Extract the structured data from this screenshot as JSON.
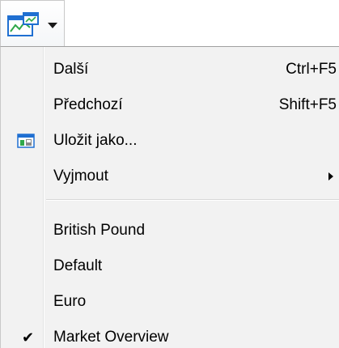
{
  "toolbar": {
    "button_icon": "chart-window-icon",
    "arrow_icon": "dropdown-arrow-icon"
  },
  "menu": {
    "items": [
      {
        "label": "Další",
        "shortcut": "Ctrl+F5"
      },
      {
        "label": "Předchozí",
        "shortcut": "Shift+F5"
      },
      {
        "label": "Uložit jako...",
        "icon": "save-as-icon"
      },
      {
        "label": "Vyjmout",
        "submenu": true
      }
    ],
    "templates": [
      {
        "label": "British Pound"
      },
      {
        "label": "Default"
      },
      {
        "label": "Euro"
      },
      {
        "label": "Market Overview",
        "checked": true
      }
    ],
    "check_glyph": "✔"
  },
  "colors": {
    "menu_background": "#f2f2f2",
    "icon_blue": "#1f6fd1",
    "icon_green": "#2fa84a"
  }
}
